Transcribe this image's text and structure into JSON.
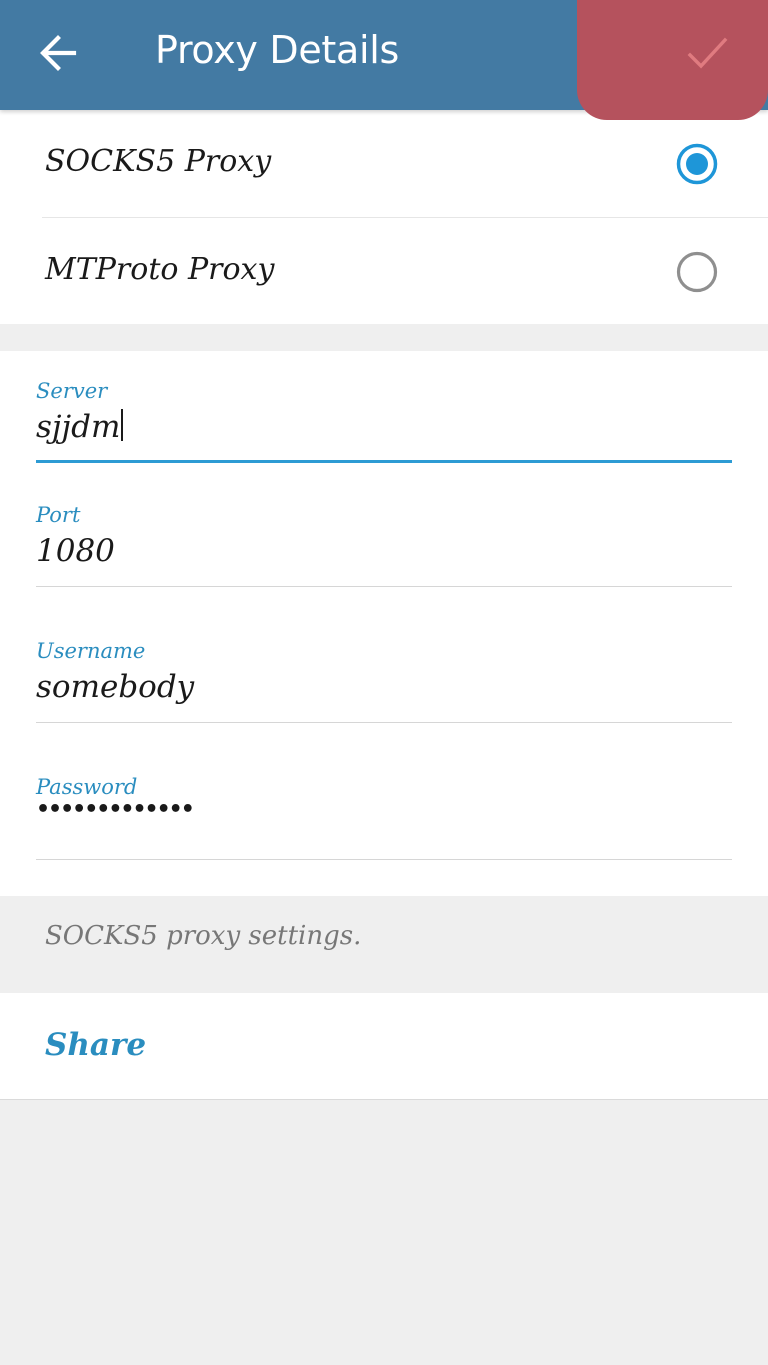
{
  "header": {
    "title": "Proxy Details",
    "back_icon": "arrow-left-icon",
    "done_icon": "checkmark-icon",
    "bar_color": "#437aa3",
    "done_highlight_color": "#b5525d"
  },
  "proxy_types": [
    {
      "label": "SOCKS5 Proxy",
      "selected": true
    },
    {
      "label": "MTProto Proxy",
      "selected": false
    }
  ],
  "form": {
    "server": {
      "label": "Server",
      "value": "sjjdm"
    },
    "port": {
      "label": "Port",
      "value": "1080"
    },
    "username": {
      "label": "Username",
      "value": "somebody"
    },
    "password": {
      "label": "Password",
      "value": "•••••••••••••"
    }
  },
  "info_text": "SOCKS5 proxy settings.",
  "share_label": "Share",
  "accent_color": "#2d9bd4"
}
